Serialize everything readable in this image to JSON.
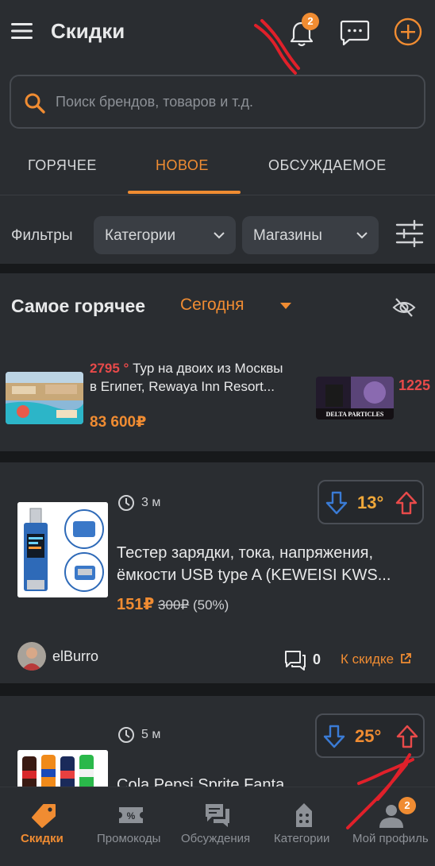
{
  "colors": {
    "accent": "#f08c32",
    "hot": "#e84a4a",
    "cold": "#3a7bd5",
    "background": "#2a2d31"
  },
  "header": {
    "title": "Скидки",
    "notifications_count": "2",
    "icons": [
      "menu-icon",
      "bell-icon",
      "chat-icon",
      "plus-icon"
    ]
  },
  "search": {
    "placeholder": "Поиск брендов, товаров и т.д."
  },
  "tabs": [
    {
      "label": "ГОРЯЧЕЕ",
      "active": false
    },
    {
      "label": "НОВОЕ",
      "active": true
    },
    {
      "label": "ОБСУЖДАЕМОЕ",
      "active": false
    }
  ],
  "filters": {
    "label": "Фильтры",
    "categories": "Категории",
    "shops": "Магазины"
  },
  "hot": {
    "title": "Самое горячее",
    "period": "Сегодня",
    "items": [
      {
        "temperature": "2795 °",
        "title": "Тур на двоих из Москвы в Египет, Rewaya Inn Resort...",
        "price": "83 600₽"
      },
      {
        "temperature": "1225",
        "image_text": "DELTA PARTICLES"
      }
    ]
  },
  "deals": [
    {
      "time": "3 м",
      "temperature": "13°",
      "title_line1": "Тестер зарядки, тока, напряжения,",
      "title_line2": "ёмкости USB type A (KEWEISI KWS...",
      "price": "151₽",
      "old_price": "300₽",
      "discount": "(50%)",
      "user": "elBurro",
      "comments": "0",
      "link": "К скидке"
    },
    {
      "time": "5 м",
      "temperature": "25°",
      "title_line1": "Cola Pepsi Sprite Fanta"
    }
  ],
  "bottom_nav": [
    {
      "label": "Скидки",
      "active": true
    },
    {
      "label": "Промокоды",
      "active": false
    },
    {
      "label": "Обсуждения",
      "active": false
    },
    {
      "label": "Категории",
      "active": false
    },
    {
      "label": "Мой профиль",
      "active": false,
      "badge": "2"
    }
  ]
}
